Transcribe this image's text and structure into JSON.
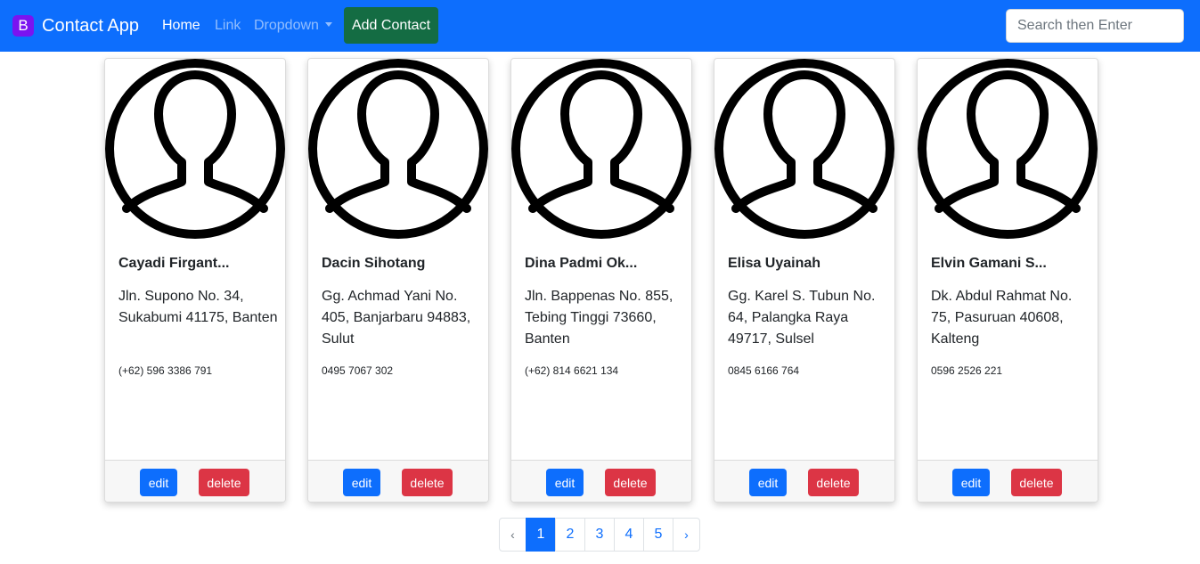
{
  "navbar": {
    "brand_logo": "B",
    "brand_text": "Contact App",
    "links": [
      {
        "label": "Home"
      },
      {
        "label": "Link"
      },
      {
        "label": "Dropdown"
      }
    ],
    "add_button": "Add Contact",
    "search_placeholder": "Search then Enter",
    "colors": {
      "background": "#0d6efd",
      "add_button": "#146c43",
      "logo": "#7a14f0"
    }
  },
  "contacts": [
    {
      "name": "Cayadi Firgant...",
      "address": "Jln. Supono No. 34, Sukabumi 41175, Banten",
      "phone": "(+62) 596 3386 791",
      "edit": "edit",
      "delete": "delete"
    },
    {
      "name": "Dacin Sihotang",
      "address": "Gg. Achmad Yani No. 405, Banjarbaru 94883, Sulut",
      "phone": "0495 7067 302",
      "edit": "edit",
      "delete": "delete"
    },
    {
      "name": "Dina Padmi Ok...",
      "address": "Jln. Bappenas No. 855, Tebing Tinggi 73660, Banten",
      "phone": "(+62) 814 6621 134",
      "edit": "edit",
      "delete": "delete"
    },
    {
      "name": "Elisa Uyainah",
      "address": "Gg. Karel S. Tubun No. 64, Palangka Raya 49717, Sulsel",
      "phone": "0845 6166 764",
      "edit": "edit",
      "delete": "delete"
    },
    {
      "name": "Elvin Gamani S...",
      "address": "Dk. Abdul Rahmat No. 75, Pasuruan 40608, Kalteng",
      "phone": "0596 2526 221",
      "edit": "edit",
      "delete": "delete"
    }
  ],
  "pagination": {
    "prev": "‹",
    "pages": [
      "1",
      "2",
      "3",
      "4",
      "5"
    ],
    "next": "›",
    "current": "1"
  },
  "colors": {
    "edit": "#0d6efd",
    "delete": "#dc3545"
  }
}
